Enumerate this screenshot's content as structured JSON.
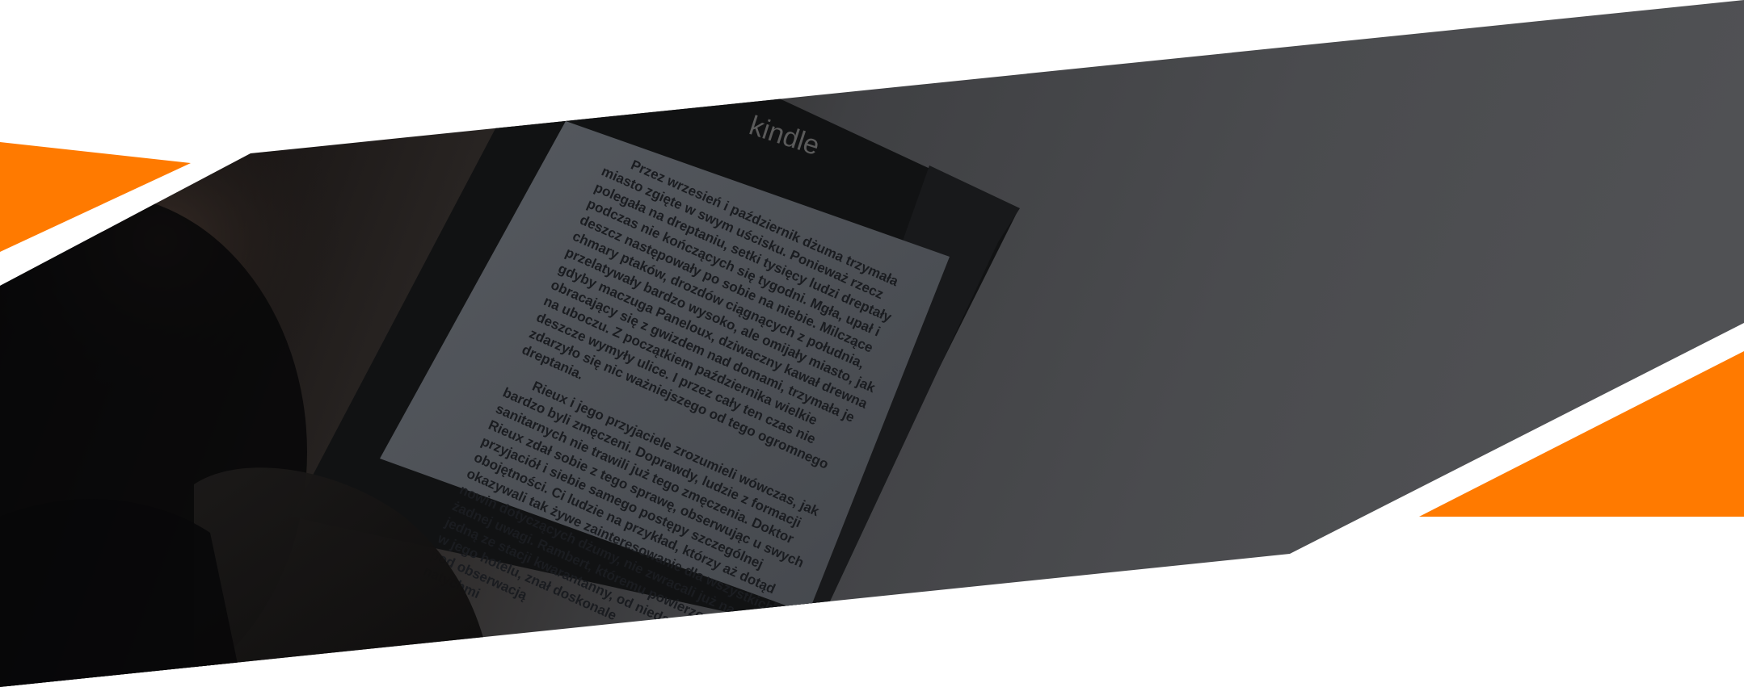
{
  "colors": {
    "accent": "#ff7a00",
    "background": "#ffffff",
    "banner_dark": "#0c0c0e",
    "banner_gray": "#4a4b4e"
  },
  "photo": {
    "device_logo": "kindle",
    "page_lines": [
      "Przez wrzesień i październik dżuma trzymała",
      "miasto zgięte w swym uścisku. Ponieważ rzecz",
      "polegała na dreptaniu, setki tysięcy ludzi dreptały",
      "podczas nie kończących się tygodni. Mgła, upał i",
      "deszcz następowały po sobie na niebie. Milczące",
      "chmary ptaków, drozdów ciągnących z południa,",
      "przelatywały bardzo wysoko, ale omijały miasto, jak",
      "gdyby maczuga Paneloux, dziwaczny kawał drewna",
      "obracający się z gwizdem nad domami, trzymała je",
      "na uboczu. Z początkiem października wielkie",
      "deszcze wymyły ulice. I przez cały ten czas nie",
      "zdarzyło się nic ważniejszego od tego ogromnego",
      "dreptania.",
      "",
      "Rieux i jego przyjaciele zrozumieli wówczas, jak",
      "bardzo byli zmęczeni. Doprawdy, ludzie z formacji",
      "sanitarnych nie trawili już tego zmęczenia. Doktor",
      "Rieux zdał sobie z tego sprawę, obserwując u swych",
      "przyjaciół i siebie samego postępy szczególnej",
      "obojętności. Ci ludzie na przykład, którzy aż dotąd",
      "okazywali tak żywe zainteresowanie dla wszystkich",
      "nowin dotyczących dżumy, nie zwracali już na",
      "żadnej uwagi. Rambert, któremu powierzono",
      "jedną ze stacji kwarantanny, od niedawna",
      "w jego hotelu, znał doskonale",
      "pod obserwacją",
      "natychmi"
    ]
  }
}
